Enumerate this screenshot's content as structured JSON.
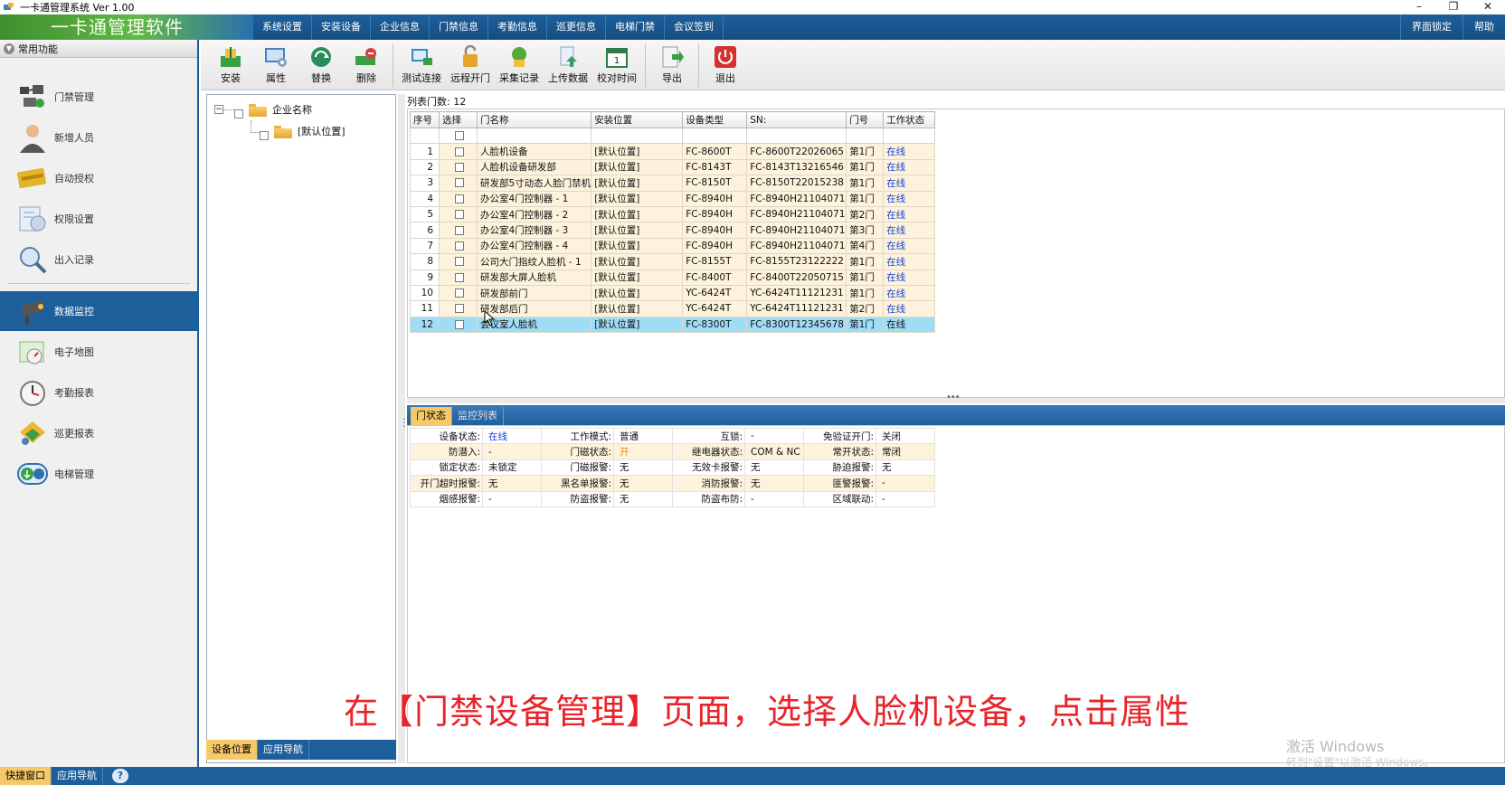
{
  "window": {
    "title": "一卡通管理系统  Ver 1.00",
    "controls": [
      "–",
      "❐",
      "✕"
    ]
  },
  "brand": "一卡通管理软件",
  "menu": [
    "系统设置",
    "安装设备",
    "企业信息",
    "门禁信息",
    "考勤信息",
    "巡更信息",
    "电梯门禁",
    "会议签到"
  ],
  "menu_right": [
    "界面锁定",
    "帮助"
  ],
  "sidebar": {
    "header": "常用功能",
    "items": [
      {
        "label": "门禁管理",
        "icon": "door-access-icon"
      },
      {
        "label": "新增人员",
        "icon": "person-icon"
      },
      {
        "label": "自动授权",
        "icon": "card-icon"
      },
      {
        "label": "权限设置",
        "icon": "permission-icon"
      },
      {
        "label": "出入记录",
        "icon": "magnifier-icon"
      }
    ],
    "items2": [
      {
        "label": "数据监控",
        "icon": "camera-icon"
      },
      {
        "label": "电子地图",
        "icon": "map-icon"
      },
      {
        "label": "考勤报表",
        "icon": "clock-icon"
      },
      {
        "label": "巡更报表",
        "icon": "patrol-icon"
      },
      {
        "label": "电梯管理",
        "icon": "elevator-icon"
      }
    ],
    "active_index": 0
  },
  "toolbar": [
    {
      "label": "安装",
      "icon": "install-icon",
      "color": "#3aa046"
    },
    {
      "label": "属性",
      "icon": "properties-icon",
      "color": "#4a7fc0"
    },
    {
      "label": "替换",
      "icon": "replace-icon",
      "color": "#2a8c5a"
    },
    {
      "label": "删除",
      "icon": "delete-icon",
      "color": "#d44040"
    },
    {
      "label": "测试连接",
      "icon": "test-connection-icon",
      "color": "#3a8ac0"
    },
    {
      "label": "远程开门",
      "icon": "remote-open-icon",
      "color": "#e3a52a"
    },
    {
      "label": "采集记录",
      "icon": "collect-records-icon",
      "color": "#58a83a"
    },
    {
      "label": "上传数据",
      "icon": "upload-data-icon",
      "color": "#3a9a6a"
    },
    {
      "label": "校对时间",
      "icon": "calendar-icon",
      "color": "#2f7a4a"
    },
    {
      "label": "导出",
      "icon": "export-icon",
      "color": "#3aa046"
    },
    {
      "label": "退出",
      "icon": "power-icon",
      "color": "#d63030"
    }
  ],
  "tree": {
    "root": "企业名称",
    "child": "[默认位置]"
  },
  "tree_tabs": [
    "设备位置",
    "应用导航"
  ],
  "list_count": "列表门数: 12",
  "grid": {
    "columns": [
      "序号",
      "选择",
      "门名称",
      "安装位置",
      "设备类型",
      "SN:",
      "门号",
      "工作状态"
    ],
    "rows": [
      {
        "idx": "1",
        "name": "人脸机设备",
        "loc": "[默认位置]",
        "type": "FC-8600T",
        "sn": "FC-8600T22026065",
        "door": "第1门",
        "status": "在线"
      },
      {
        "idx": "2",
        "name": "人脸机设备研发部",
        "loc": "[默认位置]",
        "type": "FC-8143T",
        "sn": "FC-8143T13216546",
        "door": "第1门",
        "status": "在线"
      },
      {
        "idx": "3",
        "name": "研发部5寸动态人脸门禁机",
        "loc": "[默认位置]",
        "type": "FC-8150T",
        "sn": "FC-8150T22015238",
        "door": "第1门",
        "status": "在线"
      },
      {
        "idx": "4",
        "name": "办公室4门控制器 - 1",
        "loc": "[默认位置]",
        "type": "FC-8940H",
        "sn": "FC-8940H21104071",
        "door": "第1门",
        "status": "在线"
      },
      {
        "idx": "5",
        "name": "办公室4门控制器 - 2",
        "loc": "[默认位置]",
        "type": "FC-8940H",
        "sn": "FC-8940H21104071",
        "door": "第2门",
        "status": "在线"
      },
      {
        "idx": "6",
        "name": "办公室4门控制器 - 3",
        "loc": "[默认位置]",
        "type": "FC-8940H",
        "sn": "FC-8940H21104071",
        "door": "第3门",
        "status": "在线"
      },
      {
        "idx": "7",
        "name": "办公室4门控制器 - 4",
        "loc": "[默认位置]",
        "type": "FC-8940H",
        "sn": "FC-8940H21104071",
        "door": "第4门",
        "status": "在线"
      },
      {
        "idx": "8",
        "name": "公司大门指纹人脸机 - 1",
        "loc": "[默认位置]",
        "type": "FC-8155T",
        "sn": "FC-8155T23122222",
        "door": "第1门",
        "status": "在线"
      },
      {
        "idx": "9",
        "name": "研发部大屏人脸机",
        "loc": "[默认位置]",
        "type": "FC-8400T",
        "sn": "FC-8400T22050715",
        "door": "第1门",
        "status": "在线"
      },
      {
        "idx": "10",
        "name": "研发部前门",
        "loc": "[默认位置]",
        "type": "YC-6424T",
        "sn": "YC-6424T11121231",
        "door": "第1门",
        "status": "在线"
      },
      {
        "idx": "11",
        "name": "研发部后门",
        "loc": "[默认位置]",
        "type": "YC-6424T",
        "sn": "YC-6424T11121231",
        "door": "第2门",
        "status": "在线"
      },
      {
        "idx": "12",
        "name": "会议室人脸机",
        "loc": "[默认位置]",
        "type": "FC-8300T",
        "sn": "FC-8300T12345678",
        "door": "第1门",
        "status": "在线"
      }
    ],
    "selected_index": 11
  },
  "bottom_tabs": [
    "门状态",
    "监控列表"
  ],
  "door_status": [
    [
      [
        "设备状态:",
        "在线",
        "online"
      ],
      [
        "工作模式:",
        "普通",
        ""
      ],
      [
        "互锁:",
        "-",
        ""
      ],
      [
        "免验证开门:",
        "关闭",
        ""
      ]
    ],
    [
      [
        "防潜入:",
        "-",
        ""
      ],
      [
        "门磁状态:",
        "开",
        "orange"
      ],
      [
        "继电器状态:",
        "COM & NC",
        ""
      ],
      [
        "常开状态:",
        "常闭",
        ""
      ]
    ],
    [
      [
        "锁定状态:",
        "未锁定",
        ""
      ],
      [
        "门磁报警:",
        "无",
        ""
      ],
      [
        "无效卡报警:",
        "无",
        ""
      ],
      [
        "胁迫报警:",
        "无",
        ""
      ]
    ],
    [
      [
        "开门超时报警:",
        "无",
        ""
      ],
      [
        "黑名单报警:",
        "无",
        ""
      ],
      [
        "消防报警:",
        "无",
        ""
      ],
      [
        "匪警报警:",
        "-",
        ""
      ]
    ],
    [
      [
        "烟感报警:",
        "-",
        ""
      ],
      [
        "防盗报警:",
        "无",
        ""
      ],
      [
        "防盗布防:",
        "-",
        ""
      ],
      [
        "区域联动:",
        "-",
        ""
      ]
    ]
  ],
  "caption": "在【门禁设备管理】页面，选择人脸机设备，点击属性",
  "watermark": "激活 Windows",
  "watermark_sub": "转到\"设置\"以激活 Windows。",
  "footer_tabs": [
    "快捷窗口",
    "应用导航"
  ],
  "help_glyph": "?",
  "colors": {
    "menubar": "#1d5f9b",
    "selection": "#9fdcf5",
    "row_bg": "#fdf3dc",
    "tab_active": "#f5c96a",
    "online": "#1a3fd0",
    "caption": "#e8232a"
  }
}
